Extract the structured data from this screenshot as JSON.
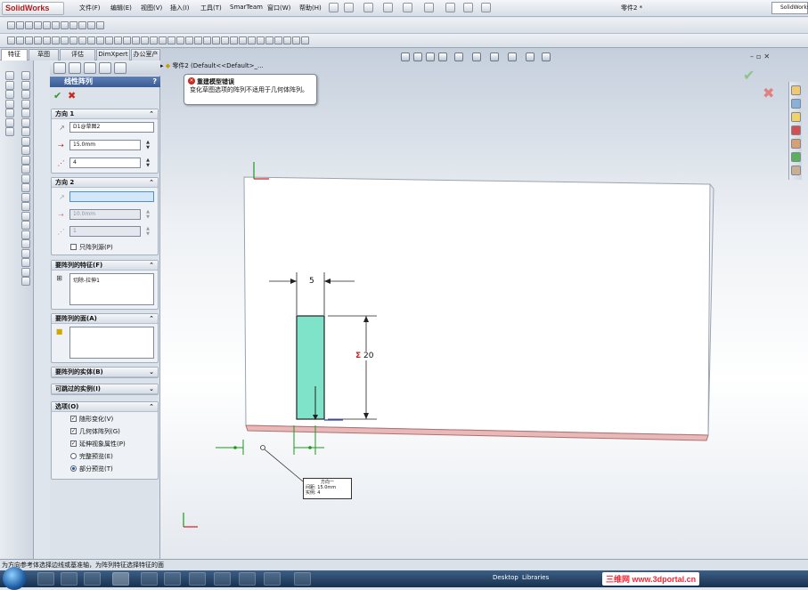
{
  "app": {
    "logo_text": "SolidWorks",
    "doc_title": "零件2 *",
    "search_text": "SolidWorks"
  },
  "menu": [
    "文件(F)",
    "编辑(E)",
    "视图(V)",
    "插入(I)",
    "工具(T)",
    "SmarTeam",
    "窗口(W)",
    "帮助(H)"
  ],
  "tabs": [
    "特征",
    "草图",
    "评估",
    "DimXpert",
    "办公室产品"
  ],
  "tree": {
    "root_label": "零件2  (Default<<Default>_..."
  },
  "error_popup": {
    "title": "重建模型错误",
    "message": "变化草图选项的阵列不适用于几何体阵列。"
  },
  "pm": {
    "title": "线性阵列",
    "help": "?",
    "ok": "✔",
    "cancel": "✖",
    "dir1": {
      "title": "方向 1",
      "edge_value": "D1@草图2",
      "spacing": "15.0mm",
      "count": "4"
    },
    "dir2": {
      "title": "方向 2",
      "edge_value": "",
      "spacing": "10.0mm",
      "count": "1",
      "seed_only_label": "只阵列源(P)"
    },
    "features": {
      "title": "要阵列的特征(F)",
      "items": [
        "切除-拉伸1"
      ]
    },
    "faces": {
      "title": "要阵列的面(A)"
    },
    "bodies": {
      "title": "要阵列的实体(B)"
    },
    "skip": {
      "title": "可跳过的实例(I)"
    },
    "options": {
      "title": "选项(O)",
      "vary_sketch": "随形变化(V)",
      "geometry_pattern": "几何体阵列(G)",
      "propagate_visual": "延伸视象属性(P)",
      "full_preview": "完整预览(E)",
      "partial_preview": "部分预览(T)"
    }
  },
  "drawing": {
    "dim_width": "5",
    "dim_height": "20",
    "sigma": "Σ",
    "callout_title": "方向一",
    "callout_spacing_label": "间距:",
    "callout_spacing": "15.0mm",
    "callout_count_label": "实例:",
    "callout_count": "4"
  },
  "status": {
    "text": "为方向参考体选择边线或基准轴，为阵列特征选择特征的面"
  },
  "taskbar": {
    "desktop": "Desktop",
    "libraries": "Libraries",
    "brand": "三维网 www.3dportal.cn"
  },
  "colors": {
    "accent": "#3a5c92",
    "cut_feature": "#7fe3c9",
    "error": "#c8281e"
  }
}
